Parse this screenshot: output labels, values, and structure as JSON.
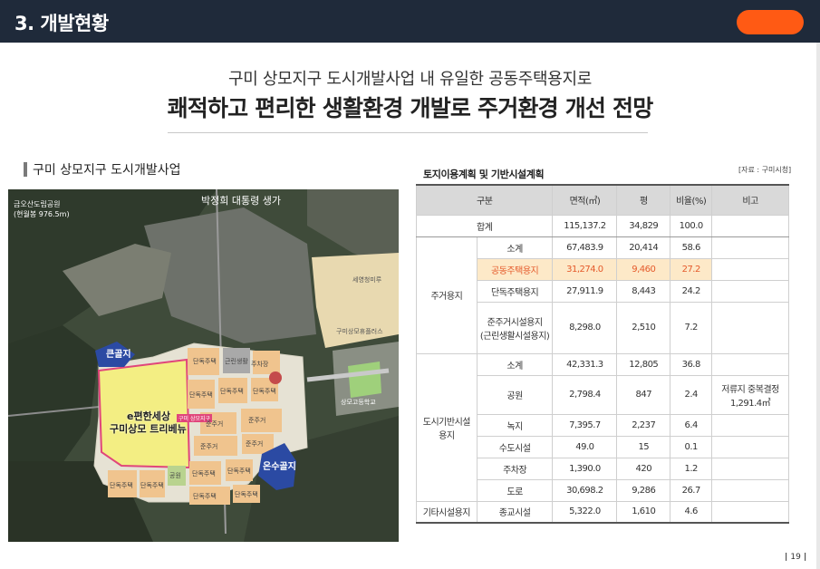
{
  "header": {
    "title": "3. 개발현황"
  },
  "headline": {
    "line1": "구미 상모지구 도시개발사업 내 유일한 공동주택용지로",
    "line2": "쾌적하고 편리한 생활환경 개발로 주거환경 개선 전망"
  },
  "section": {
    "title": "구미 상모지구 도시개발사업"
  },
  "map": {
    "park_label": "금오산도립공원",
    "park_area": "(현월봉 976.5m)",
    "birthplace": "박정희 대통령 생가",
    "big_hill": "큰골지",
    "small_hill": "온수골지",
    "site_name_1": "e편한세상",
    "site_name_2": "구미상모 트리베뉴",
    "site_tag": "구미 상모지구",
    "school": "상모고등학교",
    "apt1": "세영청미루",
    "apt2": "구미상모휴플러스",
    "plot_labels": [
      "단독주택",
      "단독주택",
      "근린생활",
      "단독주택",
      "주차장",
      "단독주택",
      "준주거",
      "준주거",
      "준주거",
      "준주거",
      "단독주택",
      "단독주택",
      "단독주택",
      "단독주택",
      "단독주택",
      "단독주택",
      "공원"
    ]
  },
  "table": {
    "title": "토지이용계획 및 기반시설계획",
    "source": "[자료 : 구미시청]",
    "headers": [
      "구분",
      "면적(㎡)",
      "평",
      "비율(%)",
      "비고"
    ],
    "total": {
      "label": "합계",
      "area": "115,137.2",
      "pyeong": "34,829",
      "ratio": "100.0"
    },
    "residential": {
      "group": "주거용지",
      "rows": [
        {
          "label": "소계",
          "area": "67,483.9",
          "pyeong": "20,414",
          "ratio": "58.6"
        },
        {
          "label": "공동주택용지",
          "area": "31,274.0",
          "pyeong": "9,460",
          "ratio": "27.2"
        },
        {
          "label": "단독주택용지",
          "area": "27,911.9",
          "pyeong": "8,443",
          "ratio": "24.2"
        },
        {
          "label1": "준주거시설용지",
          "label2": "(근린생활시설용지)",
          "area": "8,298.0",
          "pyeong": "2,510",
          "ratio": "7.2"
        }
      ]
    },
    "infra": {
      "group1": "도시기반시설",
      "group2": "용지",
      "rows": [
        {
          "label": "소계",
          "area": "42,331.3",
          "pyeong": "12,805",
          "ratio": "36.8"
        },
        {
          "label": "공원",
          "area": "2,798.4",
          "pyeong": "847",
          "ratio": "2.4",
          "note1": "저류지 중복결정",
          "note2": "1,291.4㎡"
        },
        {
          "label": "녹지",
          "area": "7,395.7",
          "pyeong": "2,237",
          "ratio": "6.4"
        },
        {
          "label": "수도시설",
          "area": "49.0",
          "pyeong": "15",
          "ratio": "0.1"
        },
        {
          "label": "주차장",
          "area": "1,390.0",
          "pyeong": "420",
          "ratio": "1.2"
        },
        {
          "label": "도로",
          "area": "30,698.2",
          "pyeong": "9,286",
          "ratio": "26.7"
        }
      ]
    },
    "other": {
      "group": "기타시설용지",
      "label": "종교시설",
      "area": "5,322.0",
      "pyeong": "1,610",
      "ratio": "4.6"
    }
  },
  "page": {
    "number": "19"
  },
  "colors": {
    "header_bg": "#1f2a3a",
    "badge": "#ff5a14",
    "highlight_bg": "#fde9c8",
    "highlight_text": "#e55a2b",
    "site_fill": "#f2ec7a",
    "site_border": "#e0457b"
  }
}
